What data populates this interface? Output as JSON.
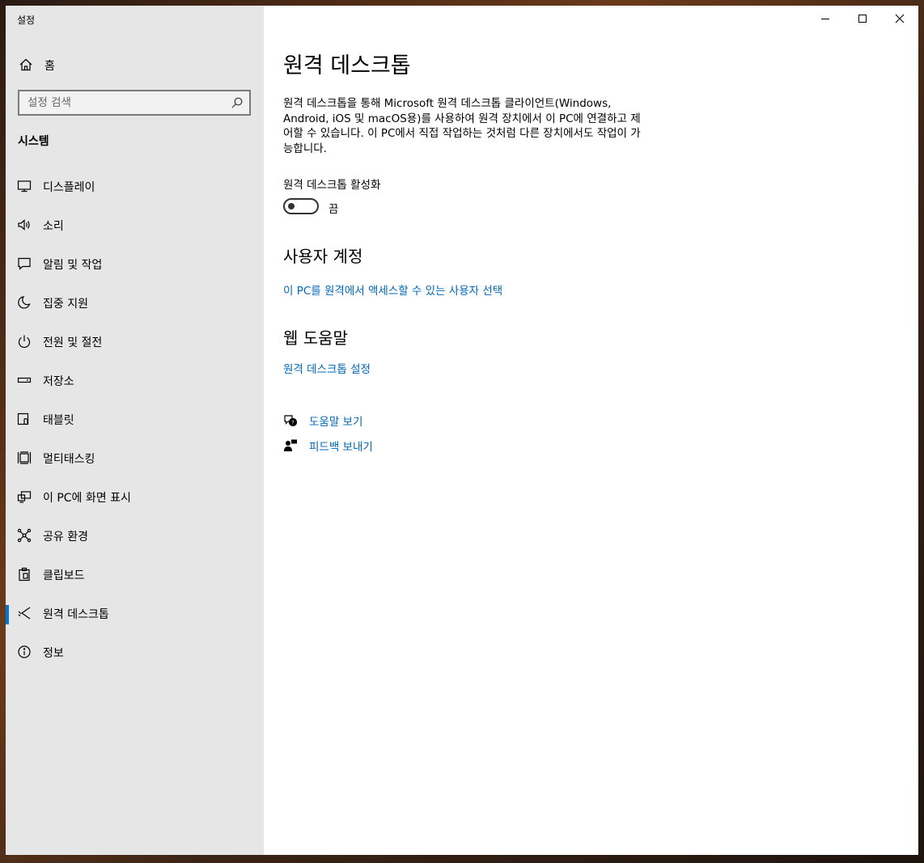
{
  "window": {
    "title": "설정"
  },
  "sidebar": {
    "home_label": "홈",
    "search_placeholder": "설정 검색",
    "section_title": "시스템",
    "items": [
      {
        "label": "디스플레이",
        "icon": "monitor-icon"
      },
      {
        "label": "소리",
        "icon": "speaker-icon"
      },
      {
        "label": "알림 및 작업",
        "icon": "notification-icon"
      },
      {
        "label": "집중 지원",
        "icon": "moon-icon"
      },
      {
        "label": "전원 및 절전",
        "icon": "power-icon"
      },
      {
        "label": "저장소",
        "icon": "storage-icon"
      },
      {
        "label": "태블릿",
        "icon": "tablet-icon"
      },
      {
        "label": "멀티태스킹",
        "icon": "multitasking-icon"
      },
      {
        "label": "이 PC에 화면 표시",
        "icon": "project-icon"
      },
      {
        "label": "공유 환경",
        "icon": "share-icon"
      },
      {
        "label": "클립보드",
        "icon": "clipboard-icon"
      },
      {
        "label": "원격 데스크톱",
        "icon": "remote-desktop-icon",
        "active": true
      },
      {
        "label": "정보",
        "icon": "info-icon"
      }
    ]
  },
  "main": {
    "title": "원격 데스크톱",
    "description": "원격 데스크톱을 통해 Microsoft 원격 데스크톱 클라이언트(Windows, Android, iOS 및 macOS용)를 사용하여 원격 장치에서 이 PC에 연결하고 제어할 수 있습니다. 이 PC에서 직접 작업하는 것처럼 다른 장치에서도 작업이 가능합니다.",
    "toggle": {
      "label": "원격 데스크톱 활성화",
      "state": "끔",
      "on": false
    },
    "user_accounts": {
      "heading": "사용자 계정",
      "link": "이 PC를 원격에서 액세스할 수 있는 사용자 선택"
    },
    "web_help": {
      "heading": "웹 도움말",
      "link": "원격 데스크톱 설정"
    },
    "help_links": {
      "get_help": "도움말 보기",
      "feedback": "피드백 보내기"
    }
  },
  "colors": {
    "accent": "#0078d7",
    "link": "#0067b8",
    "sidebar_bg": "#e6e6e6"
  }
}
